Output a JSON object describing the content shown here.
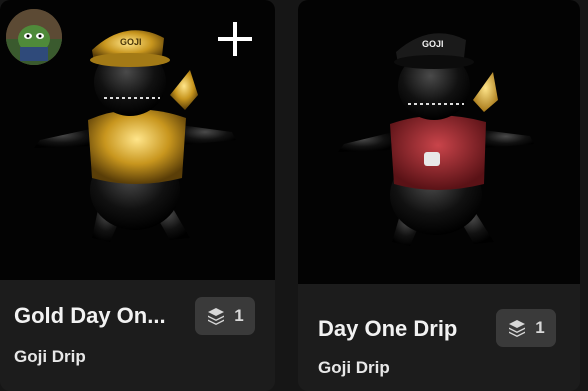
{
  "cards": [
    {
      "title": "Gold Day On...",
      "creator": "Goji Drip",
      "edition_count": "1",
      "cap_text": "GOJI",
      "icons": [
        "avatar",
        "plus-icon",
        "layers-icon"
      ],
      "accent_color": "#d4a52a"
    },
    {
      "title": "Day One Drip",
      "creator": "Goji Drip",
      "edition_count": "1",
      "cap_text": "GOJI",
      "icons": [
        "layers-icon"
      ],
      "accent_color": "#9b2a2e"
    }
  ]
}
